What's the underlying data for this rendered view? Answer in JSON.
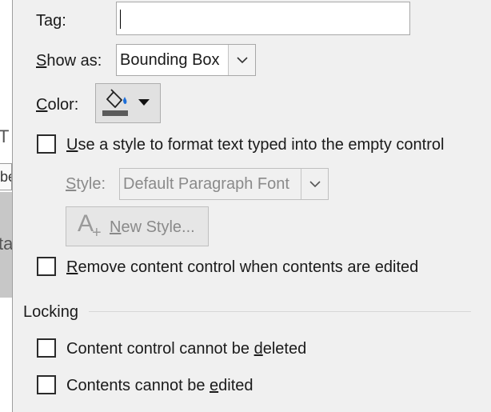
{
  "background": {
    "fragment_t": "T",
    "fragment_be": "be",
    "fragment_ta": "ta"
  },
  "general": {
    "tag_label_pre": "Ta",
    "tag_label_u": "g",
    "tag_label_post": ":",
    "tag_value": "",
    "show_as_label_u": "S",
    "show_as_label_post": "how as:",
    "show_as_value": "Bounding Box",
    "color_label_u": "C",
    "color_label_post": "olor:",
    "color_swatch": "#5b5b5b",
    "use_style_u": "U",
    "use_style_post": "se a style to format text typed into the empty control",
    "style_label_u": "S",
    "style_label_post": "tyle:",
    "style_value": "Default Paragraph Font",
    "new_style_u": "N",
    "new_style_post": "ew Style...",
    "remove_u": "R",
    "remove_post": "emove content control when contents are edited"
  },
  "locking": {
    "title": "Locking",
    "delete_pre": "Content control cannot be ",
    "delete_u": "d",
    "delete_post": "eleted",
    "edit_pre": "Contents cannot be ",
    "edit_u": "e",
    "edit_post": "dited"
  },
  "checkboxes": {
    "use_style": false,
    "remove_when_edited": false,
    "cannot_delete": false,
    "cannot_edit": false
  },
  "icons": {
    "bucket": "paint-bucket-icon",
    "dropdown": "chevron-down-icon"
  }
}
